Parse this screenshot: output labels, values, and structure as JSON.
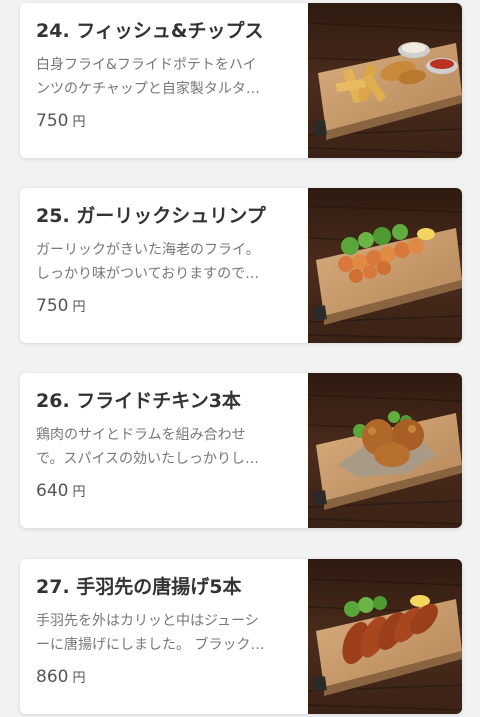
{
  "currency_label": "円",
  "items": [
    {
      "title": "24. フィッシュ&チップス",
      "desc_line1": "白身フライ&フライドポテトをハイ",
      "desc_line2": "ンツのケチャップと自家製タルタ…",
      "price": "750",
      "photo_icon": "fish-and-chips-photo"
    },
    {
      "title": "25. ガーリックシュリンプ",
      "desc_line1": "ガーリックがきいた海老のフライ。",
      "desc_line2": "しっかり味がついておりますので…",
      "price": "750",
      "photo_icon": "garlic-shrimp-photo"
    },
    {
      "title": "26. フライドチキン3本",
      "desc_line1": "鶏肉のサイとドラムを組み合わせ",
      "desc_line2": "で。スパイスの効いたしっかりし…",
      "price": "640",
      "photo_icon": "fried-chicken-photo"
    },
    {
      "title": "27. 手羽先の唐揚げ5本",
      "desc_line1": "手羽先を外はカリッと中はジューシ",
      "desc_line2": "ーに唐揚げにしました。 ブラック…",
      "price": "860",
      "photo_icon": "chicken-wings-photo"
    }
  ],
  "colors": {
    "page_background": "#f2f2f2",
    "card_background": "#ffffff",
    "title_text": "#333333",
    "description_text": "#777777",
    "price_text": "#555555",
    "wood_dark": "#3b2418",
    "board_light": "#c79a6b"
  }
}
